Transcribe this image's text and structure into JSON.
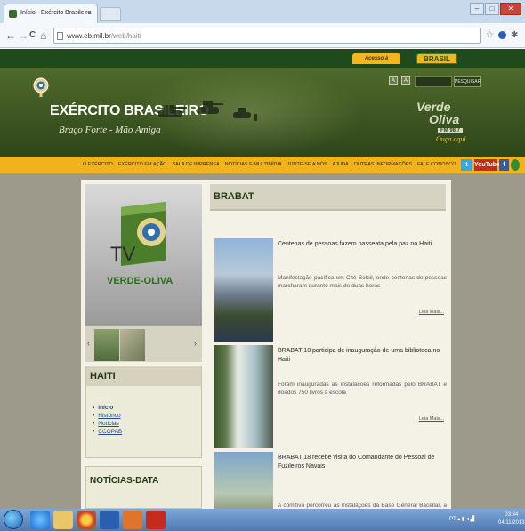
{
  "browser": {
    "tab_title": "Início - Exército Brasileiro",
    "tab_close": "×",
    "url_host": "www.eb.mil.br",
    "url_path": "/web/haiti",
    "back": "←",
    "forward": "→",
    "reload": "C",
    "home": "⌂",
    "star": "☆",
    "win_min": "–",
    "win_max": "□",
    "win_close": "✕"
  },
  "site": {
    "top_links": {
      "acesso": "Acesso à informação",
      "brasil": "BRASIL"
    },
    "brand": "EXÉRCITO BRASILEIRO",
    "motto": "Braço Forte - Mão Amiga",
    "font_a": "A",
    "font_a_big": "A",
    "search_button": "PESQUISAR",
    "radio": {
      "line1": "Verde",
      "line2": "Oliva",
      "badge": "FM 98.7",
      "tagline": "Ouça aqui"
    },
    "menu": [
      "O EXÉRCITO",
      "EXÉRCITO EM AÇÃO",
      "SALA DE IMPRENSA",
      "NOTÍCIAS E MULTIMÍDIA",
      "JUNTE-SE A NÓS",
      "AJUDA",
      "OUTRAS INFORMAÇÕES",
      "FALE CONOSCO"
    ],
    "social": {
      "twitter": "t",
      "youtube": "YouTube",
      "facebook": "f",
      "other": ""
    }
  },
  "left": {
    "tv_text": "TV",
    "tv_label": "VERDE-OLIVA",
    "arrow_prev": "‹",
    "arrow_next": "›",
    "haiti_title": "HAITI",
    "haiti_items": [
      "Início",
      "Histórico",
      "Notícias",
      "CCOPAB"
    ],
    "noticias_title": "NOTÍCIAS-DATA"
  },
  "right": {
    "section_title": "BRABAT",
    "news": [
      {
        "title": "Centenas de pessoas fazem passeata pela paz no Haiti",
        "desc": "Manifestação pacífica em Cité Soleil, onde centenas de pessoas marcharam durante mais de duas horas",
        "more": "Leia Mais..."
      },
      {
        "title": "BRABAT 18 participa de inauguração de uma biblioteca no Haiti",
        "desc": "Foram inauguradas as instalações reformadas pelo BRABAT e doados 750 livros à escola",
        "more": "Leia Mais..."
      },
      {
        "title": "BRABAT 18 recebe visita do Comandante do Pessoal de Fuzileiros Navais",
        "desc": "A comitiva percorreu as instalações da Base General Bacellar, a Área",
        "more": ""
      }
    ]
  },
  "taskbar": {
    "tray": "PT  ▴  ▮  ◂  ▟",
    "time": "03:34",
    "date": "04/11/2013"
  }
}
